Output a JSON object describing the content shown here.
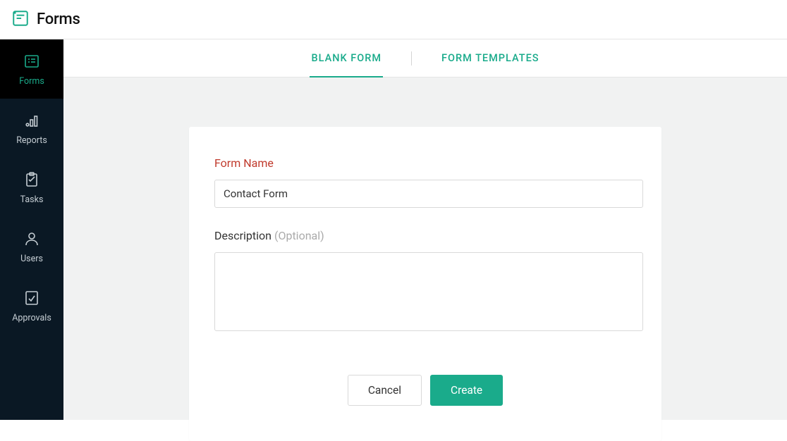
{
  "header": {
    "title": "Forms"
  },
  "sidebar": {
    "items": [
      {
        "label": "Forms"
      },
      {
        "label": "Reports"
      },
      {
        "label": "Tasks"
      },
      {
        "label": "Users"
      },
      {
        "label": "Approvals"
      }
    ]
  },
  "tabs": {
    "items": [
      {
        "label": "BLANK FORM"
      },
      {
        "label": "FORM TEMPLATES"
      }
    ]
  },
  "form": {
    "name_label": "Form Name",
    "name_value": "Contact Form",
    "desc_label": "Description ",
    "desc_optional": "(Optional)",
    "desc_value": ""
  },
  "buttons": {
    "cancel": "Cancel",
    "create": "Create"
  }
}
